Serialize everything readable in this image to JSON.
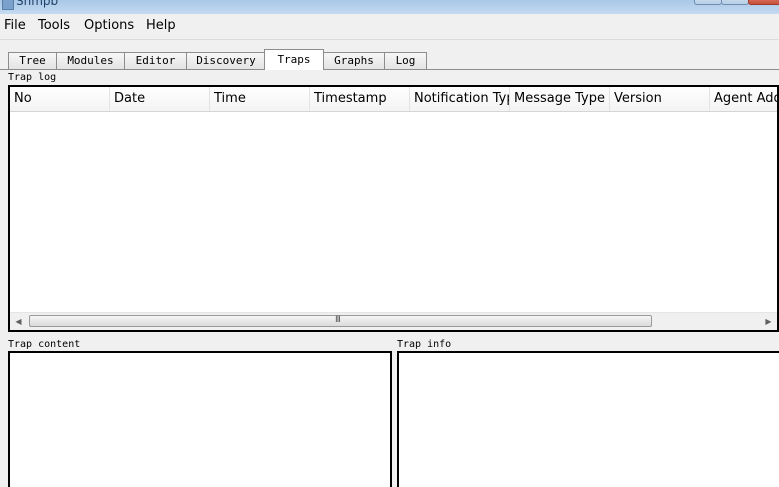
{
  "window": {
    "title": "Snmpb"
  },
  "menu": {
    "items": [
      {
        "label": "File"
      },
      {
        "label": "Tools"
      },
      {
        "label": "Options"
      },
      {
        "label": "Help"
      }
    ]
  },
  "tabs": {
    "items": [
      {
        "label": "Tree"
      },
      {
        "label": "Modules"
      },
      {
        "label": "Editor"
      },
      {
        "label": "Discovery"
      },
      {
        "label": "Traps"
      },
      {
        "label": "Graphs"
      },
      {
        "label": "Log"
      }
    ],
    "active": "Traps"
  },
  "trap_log": {
    "label": "Trap log",
    "columns": [
      {
        "label": "No"
      },
      {
        "label": "Date"
      },
      {
        "label": "Time"
      },
      {
        "label": "Timestamp"
      },
      {
        "label": "Notification Typ"
      },
      {
        "label": "Message Type"
      },
      {
        "label": "Version"
      },
      {
        "label": "Agent Addr"
      }
    ],
    "rows": [],
    "scrollbar_grip": "III"
  },
  "trap_content": {
    "label": "Trap content"
  },
  "trap_info": {
    "label": "Trap info"
  },
  "icons": {
    "scroll_left": "left-arrow-icon",
    "scroll_right": "right-arrow-icon"
  }
}
